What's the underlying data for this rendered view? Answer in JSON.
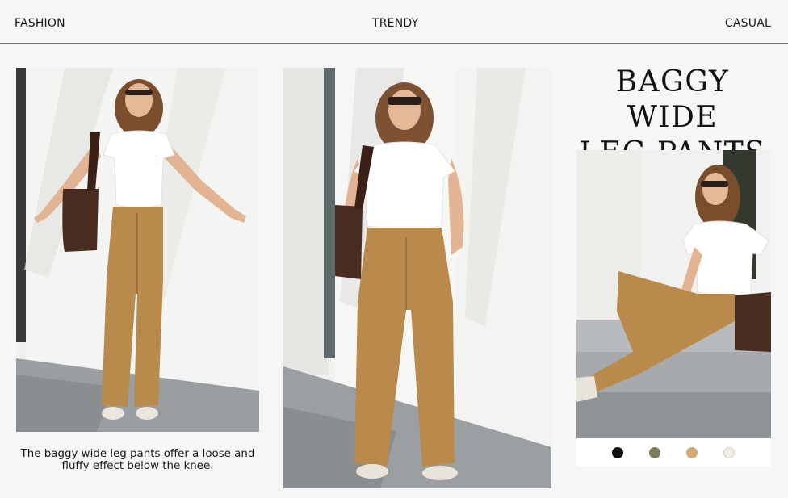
{
  "nav": {
    "left": "FASHION",
    "center": "TRENDY",
    "right": "CASUAL"
  },
  "title": {
    "line1": "BAGGY WIDE",
    "line2": "LEG PANTS"
  },
  "caption": "The baggy wide leg pants offer a loose and fluffy effect below the knee.",
  "swatches": [
    {
      "name": "black",
      "color": "#0f0f0f"
    },
    {
      "name": "olive",
      "color": "#7b7b5b"
    },
    {
      "name": "khaki",
      "color": "#d2a978"
    },
    {
      "name": "cream",
      "color": "#f3ede3"
    }
  ],
  "colors": {
    "wall": "#f2f2f0",
    "shadow": "#dcdcd8",
    "pants": "#b88a4c",
    "top": "#ffffff",
    "bag": "#4a2b1f",
    "hair": "#7a4d2c",
    "skin": "#e6b898",
    "floor": "#8f9497"
  },
  "icons": {
    "swatch": "circle-swatch-icon"
  }
}
